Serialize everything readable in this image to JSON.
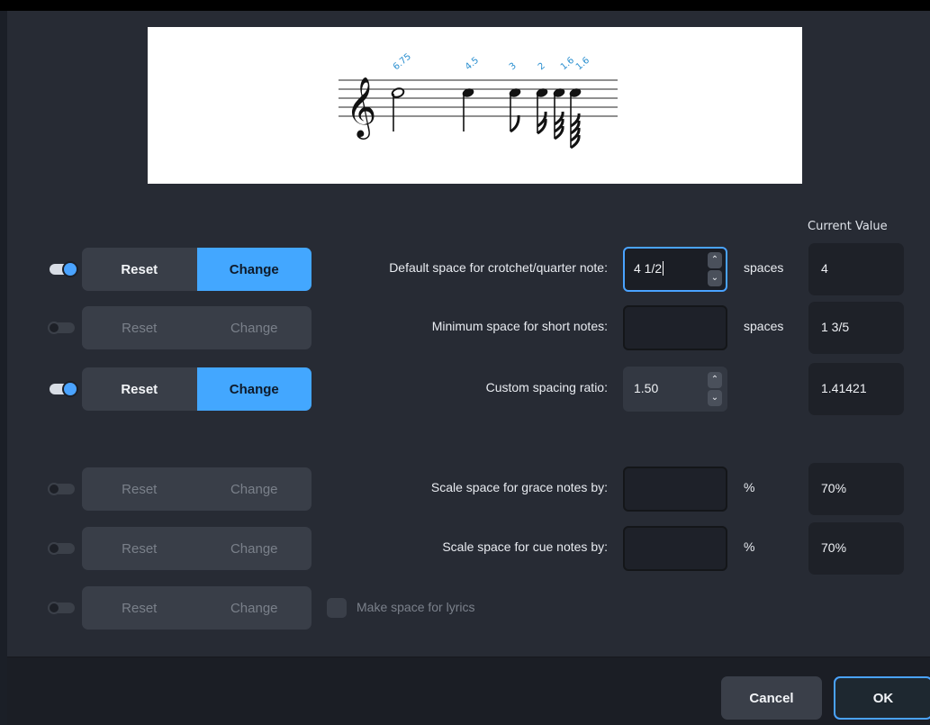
{
  "preview": {
    "annotations": [
      "6.75",
      "4.5",
      "3",
      "2",
      "1.6",
      "1.6"
    ]
  },
  "current_value_header": "Current Value",
  "rows": [
    {
      "enabled": true,
      "reset": "Reset",
      "change": "Change",
      "label": "Default space for crotchet/quarter note:",
      "value": "4 1/2",
      "unit": "spaces",
      "current": "4"
    },
    {
      "enabled": false,
      "reset": "Reset",
      "change": "Change",
      "label": "Minimum space for short notes:",
      "value": "",
      "unit": "spaces",
      "current": "1 3/5"
    },
    {
      "enabled": true,
      "reset": "Reset",
      "change": "Change",
      "label": "Custom spacing ratio:",
      "value": "1.50",
      "unit": "",
      "current": "1.41421"
    },
    {
      "enabled": false,
      "reset": "Reset",
      "change": "Change",
      "label": "Scale space for grace notes by:",
      "value": "",
      "unit": "%",
      "current": "70%"
    },
    {
      "enabled": false,
      "reset": "Reset",
      "change": "Change",
      "label": "Scale space for cue notes by:",
      "value": "",
      "unit": "%",
      "current": "70%"
    },
    {
      "enabled": false,
      "reset": "Reset",
      "change": "Change",
      "checkbox_label": "Make space for lyrics"
    }
  ],
  "footer": {
    "cancel": "Cancel",
    "ok": "OK"
  },
  "colors": {
    "accent": "#43a7ff",
    "background": "#272b34"
  }
}
